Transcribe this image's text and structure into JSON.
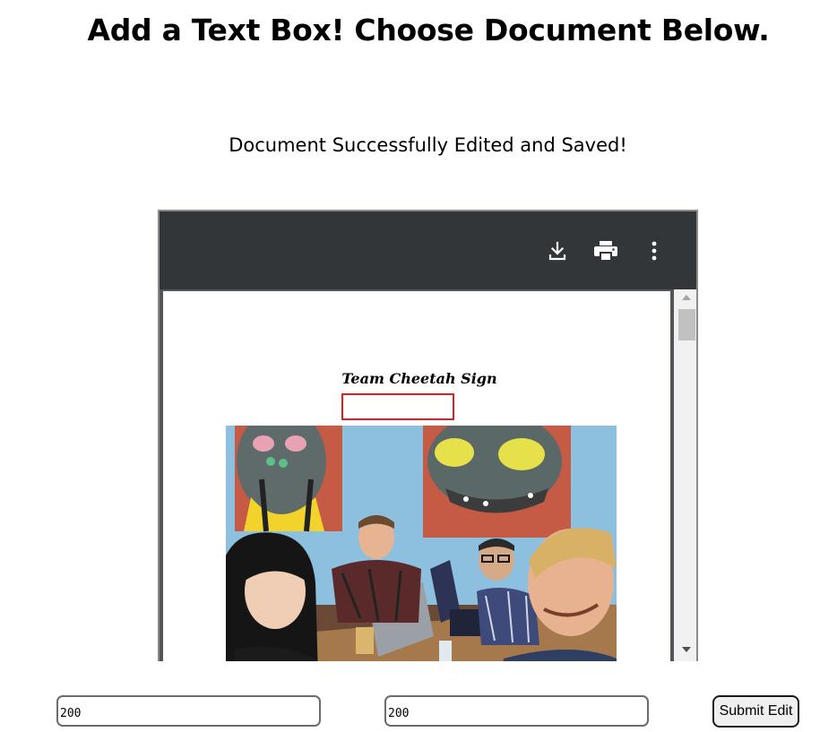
{
  "heading": "Add a Text Box! Choose Document Below.",
  "status_message": "Document Successfully Edited and Saved!",
  "viewer": {
    "toolbar_icons": [
      "download-icon",
      "print-icon",
      "more-vert-icon"
    ],
    "document": {
      "title": "Team Cheetah Sign",
      "text_box_color": "#dd1f1f"
    }
  },
  "form": {
    "x_value": "200",
    "y_value": "200",
    "submit_label": "Submit Edit"
  }
}
